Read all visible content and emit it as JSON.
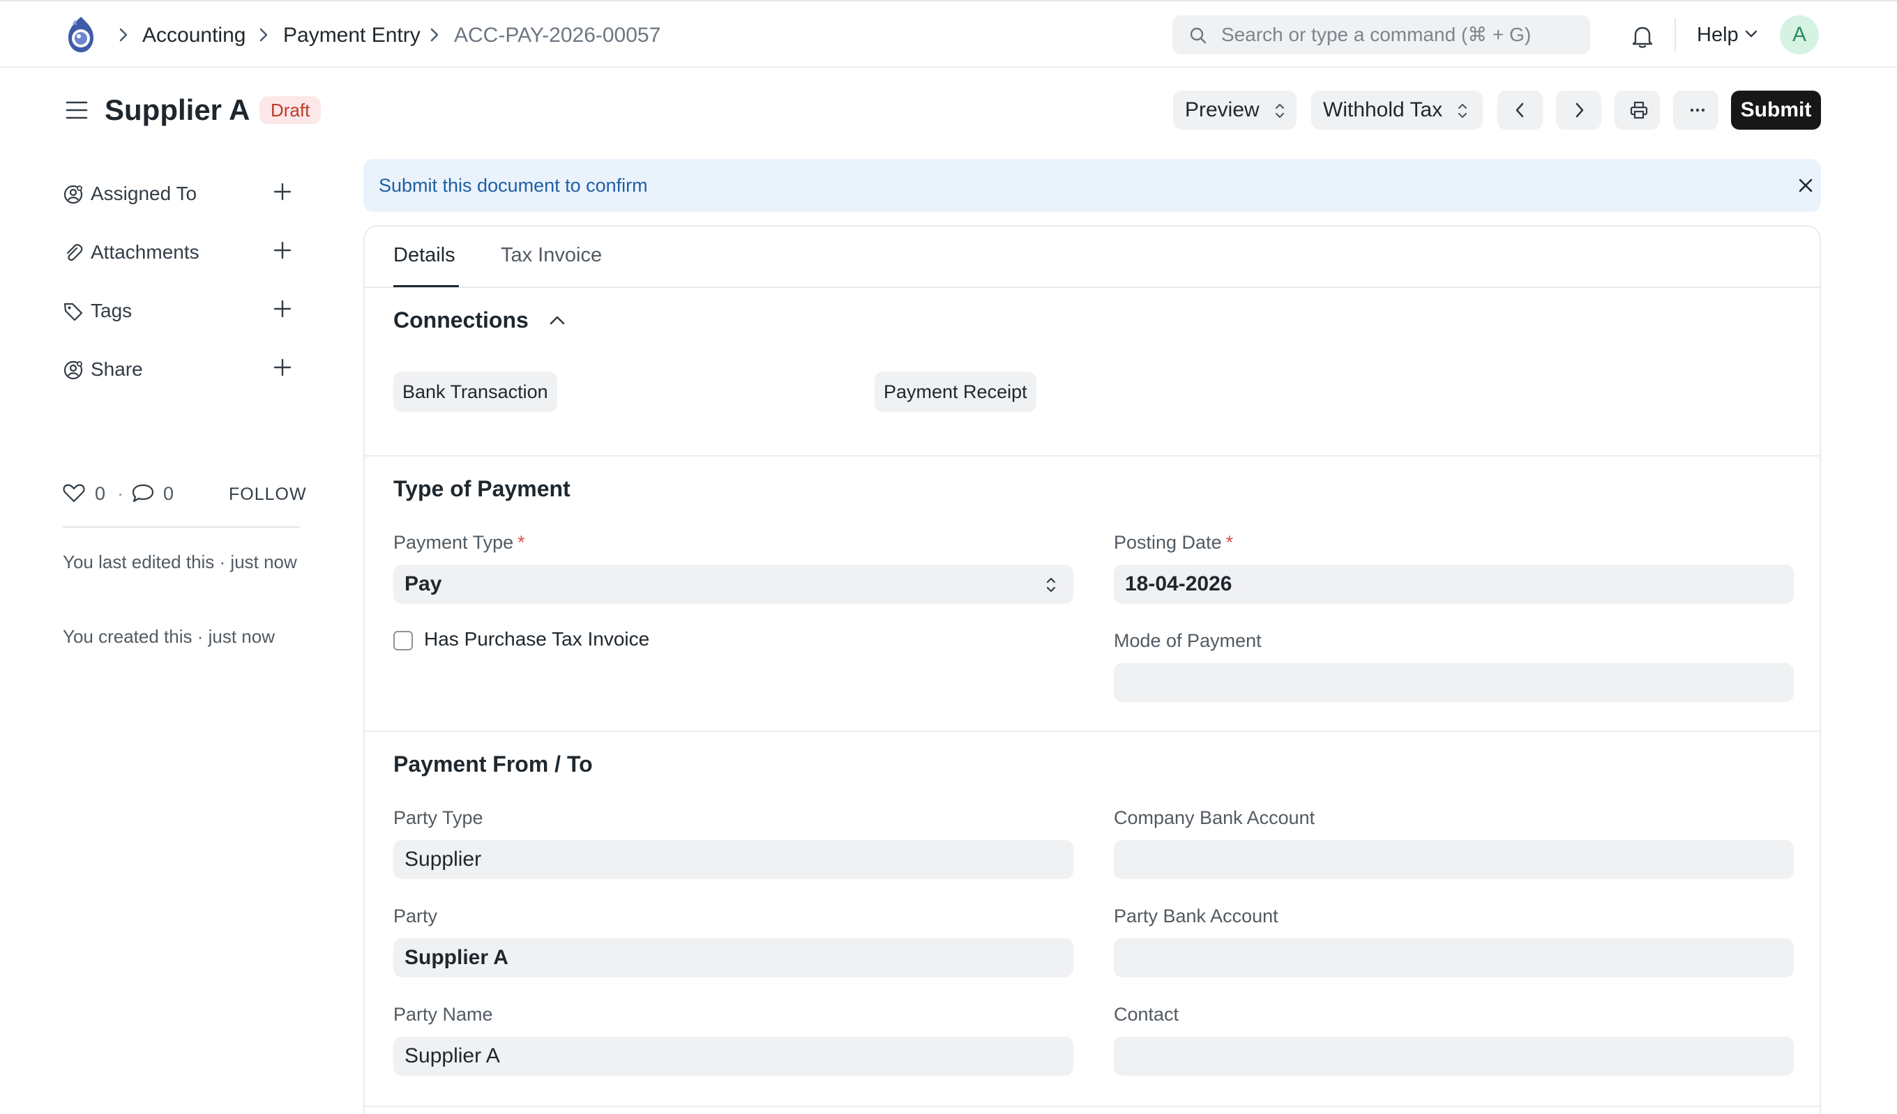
{
  "navbar": {
    "breadcrumbs": [
      {
        "label": "Accounting"
      },
      {
        "label": "Payment Entry"
      },
      {
        "label": "ACC-PAY-2026-00057"
      }
    ],
    "search_placeholder": "Search or type a command (⌘ + G)",
    "help_label": "Help",
    "avatar_initial": "A"
  },
  "page": {
    "title": "Supplier A",
    "status": "Draft",
    "actions": {
      "preview": "Preview",
      "withhold_tax": "Withhold Tax",
      "submit": "Submit"
    }
  },
  "sidebar": {
    "items": [
      {
        "label": "Assigned To"
      },
      {
        "label": "Attachments"
      },
      {
        "label": "Tags"
      },
      {
        "label": "Share"
      }
    ],
    "likes": "0",
    "comments": "0",
    "follow_label": "FOLLOW",
    "activity": [
      "You last edited this · just now",
      "You created this · just now"
    ]
  },
  "alert": {
    "message": "Submit this document to confirm"
  },
  "form": {
    "tabs": [
      {
        "label": "Details"
      },
      {
        "label": "Tax Invoice"
      }
    ],
    "connections": {
      "title": "Connections",
      "links": [
        "Bank Transaction",
        "Payment Receipt"
      ]
    },
    "type_of_payment": {
      "title": "Type of Payment",
      "payment_type_label": "Payment Type",
      "payment_type_value": "Pay",
      "has_purchase_tax_invoice_label": "Has Purchase Tax Invoice",
      "posting_date_label": "Posting Date",
      "posting_date_value": "18-04-2026",
      "mode_of_payment_label": "Mode of Payment",
      "mode_of_payment_value": ""
    },
    "payment_from_to": {
      "title": "Payment From / To",
      "party_type_label": "Party Type",
      "party_type_value": "Supplier",
      "party_label": "Party",
      "party_value": "Supplier A",
      "party_name_label": "Party Name",
      "party_name_value": "Supplier A",
      "company_bank_account_label": "Company Bank Account",
      "company_bank_account_value": "",
      "party_bank_account_label": "Party Bank Account",
      "party_bank_account_value": "",
      "contact_label": "Contact",
      "contact_value": ""
    }
  },
  "colors": {
    "primary_button": "#171717",
    "draft_badge_bg": "#fce8e8",
    "draft_badge_text": "#c0392b",
    "alert_bg": "#eaf3fc",
    "alert_text": "#1f5fa3",
    "required_marker": "#e24c4c"
  }
}
